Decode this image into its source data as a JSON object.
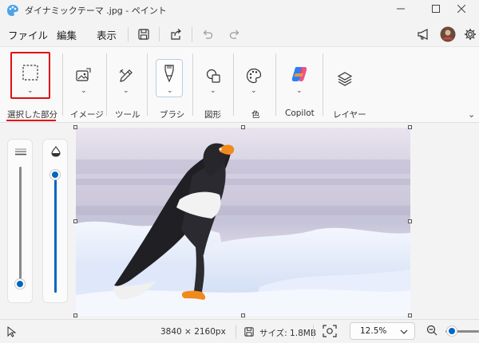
{
  "window": {
    "title": "ダイナミックテーマ .jpg - ペイント"
  },
  "menu": {
    "file": "ファイル",
    "edit": "編集",
    "view": "表示"
  },
  "ribbon": {
    "selection": "選択した部分",
    "image": "イメージ",
    "tools": "ツール",
    "brush": "ブラシ",
    "shapes": "図形",
    "color": "色",
    "copilot": "Copilot",
    "layers": "レイヤー"
  },
  "status": {
    "dimensions": "3840 × 2160px",
    "size": "サイズ: 1.8MB",
    "zoom": "12.5%"
  },
  "colors": {
    "accent": "#0067c0",
    "highlight": "#e01010"
  }
}
